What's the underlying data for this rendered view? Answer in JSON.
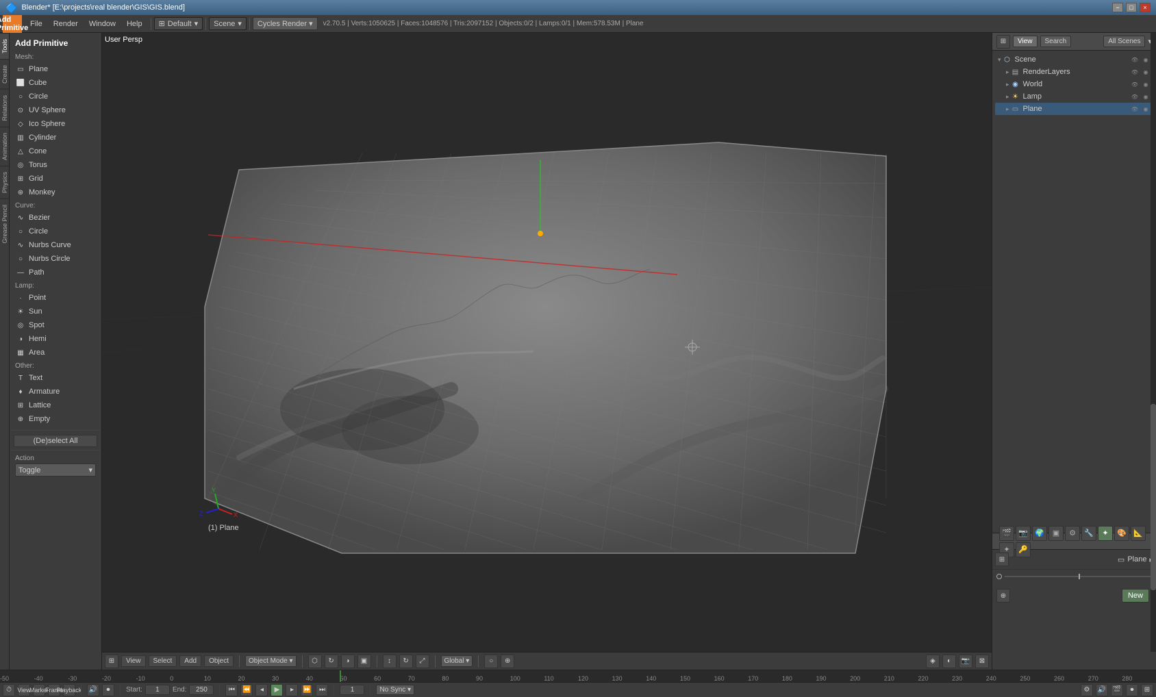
{
  "titlebar": {
    "title": "Blender* [E:\\projects\\real blender\\GIS\\GIS.blend]",
    "controls": [
      "−",
      "□",
      "×"
    ]
  },
  "menubar": {
    "logo": "B",
    "items": [
      "File",
      "Render",
      "Window",
      "Help"
    ],
    "layout": "Default",
    "scene": "Scene",
    "renderer": "Cycles Render",
    "version_info": "v2.70.5 | Verts:1050625 | Faces:1048576 | Tris:2097152 | Objects:0/2 | Lamps:0/1 | Mem:578.53M | Plane"
  },
  "add_panel": {
    "title": "Add Primitive",
    "mesh_label": "Mesh:",
    "mesh_items": [
      {
        "label": "Plane",
        "icon": "▭"
      },
      {
        "label": "Cube",
        "icon": "⬜"
      },
      {
        "label": "Circle",
        "icon": "○"
      },
      {
        "label": "UV Sphere",
        "icon": "⊙"
      },
      {
        "label": "Ico Sphere",
        "icon": "◇"
      },
      {
        "label": "Cylinder",
        "icon": "▥"
      },
      {
        "label": "Cone",
        "icon": "△"
      },
      {
        "label": "Torus",
        "icon": "◎"
      },
      {
        "label": "Grid",
        "icon": "⊞"
      },
      {
        "label": "Monkey",
        "icon": "⊛"
      }
    ],
    "curve_label": "Curve:",
    "curve_items": [
      {
        "label": "Bezier",
        "icon": "∿"
      },
      {
        "label": "Circle",
        "icon": "○"
      },
      {
        "label": "Nurbs Curve",
        "icon": "∿"
      },
      {
        "label": "Nurbs Circle",
        "icon": "○"
      },
      {
        "label": "Path",
        "icon": "—"
      }
    ],
    "lamp_label": "Lamp:",
    "lamp_items": [
      {
        "label": "Point",
        "icon": "·"
      },
      {
        "label": "Sun",
        "icon": "☀"
      },
      {
        "label": "Spot",
        "icon": "◎"
      },
      {
        "label": "Hemi",
        "icon": "◑"
      },
      {
        "label": "Area",
        "icon": "▦"
      }
    ],
    "other_label": "Other:",
    "other_items": [
      {
        "label": "Text",
        "icon": "T"
      },
      {
        "label": "Armature",
        "icon": "♦"
      },
      {
        "label": "Lattice",
        "icon": "⊞"
      },
      {
        "label": "Empty",
        "icon": "⊕"
      }
    ],
    "deselect_label": "(De)select All",
    "action_label": "Action",
    "action_value": "Toggle"
  },
  "viewport": {
    "label": "User Persp",
    "status": "(1) Plane",
    "toolbar_items": [
      "View",
      "Select",
      "Add",
      "Object"
    ],
    "mode": "Object Mode",
    "global": "Global",
    "sync_mode": "No Sync"
  },
  "outliner": {
    "header_buttons": [
      "View",
      "Search",
      "All Scenes"
    ],
    "scene_name": "Scene",
    "items": [
      {
        "label": "RenderLayers",
        "icon": "▤",
        "depth": 1,
        "expanded": false
      },
      {
        "label": "World",
        "icon": "◉",
        "depth": 1,
        "expanded": false
      },
      {
        "label": "Lamp",
        "icon": "☀",
        "depth": 1,
        "expanded": false,
        "selected": false
      },
      {
        "label": "Plane",
        "icon": "▭",
        "depth": 1,
        "expanded": false,
        "selected": true
      }
    ]
  },
  "properties": {
    "tabs": [
      "🎬",
      "📷",
      "🌍",
      "🔲",
      "⚙",
      "🔧",
      "✦",
      "🔗",
      "🎨",
      "📐",
      "🔑",
      "🔒"
    ],
    "active_tab": 0,
    "plane_name": "Plane",
    "new_btn": "New"
  },
  "timeline": {
    "start_label": "Start:",
    "start_value": "1",
    "end_label": "End:",
    "end_value": "250",
    "current_frame": "1",
    "playback_label": "Playback",
    "sync_mode": "No Sync",
    "markers": [
      "-50",
      "-40",
      "-30",
      "-20",
      "-10",
      "0",
      "10",
      "20",
      "30",
      "40",
      "50",
      "60",
      "70",
      "80",
      "90",
      "100",
      "110",
      "120",
      "130",
      "140",
      "150",
      "160",
      "170",
      "180",
      "190",
      "200",
      "210",
      "220",
      "230",
      "240",
      "250",
      "260",
      "270",
      "280"
    ]
  },
  "colors": {
    "accent_orange": "#e87b2a",
    "accent_green": "#3a8a3a",
    "accent_blue": "#3a5f80",
    "selected_blue": "#3a5a7a",
    "bg_dark": "#2a2a2a",
    "bg_mid": "#3c3c3c",
    "bg_light": "#4a4a4a",
    "text_main": "#cccccc",
    "text_dim": "#888888"
  }
}
